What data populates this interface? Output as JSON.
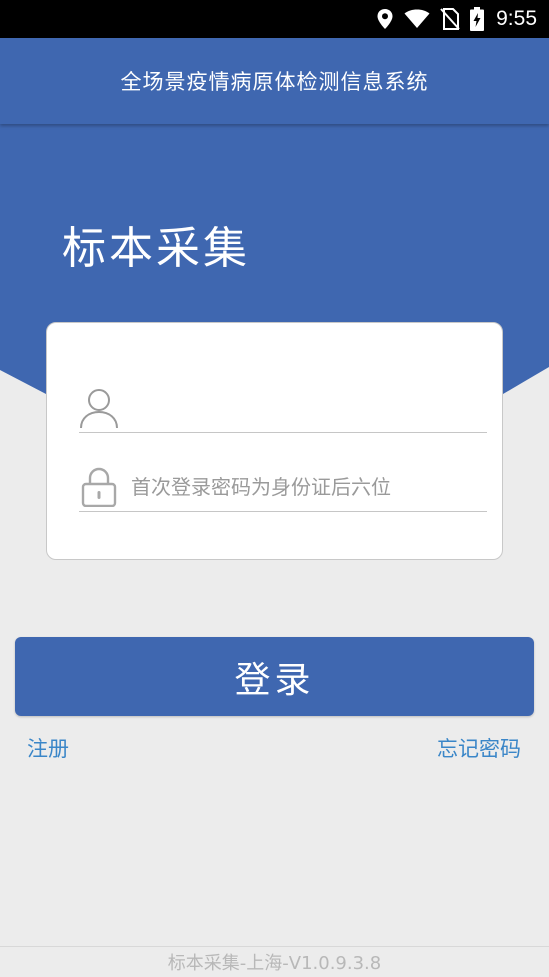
{
  "status_bar": {
    "time": "9:55",
    "icons": [
      "location-icon",
      "wifi-icon",
      "no-sim-icon",
      "battery-charging-icon"
    ]
  },
  "header": {
    "title": "全场景疫情病原体检测信息系统"
  },
  "hero": {
    "title": "标本采集"
  },
  "login": {
    "username_value": "",
    "password_placeholder": "首次登录密码为身份证后六位",
    "submit_label": "登录"
  },
  "links": {
    "register": "注册",
    "forgot_password": "忘记密码"
  },
  "footer": {
    "version": "标本采集-上海-V1.0.9.3.8"
  },
  "colors": {
    "primary": "#3f67b0",
    "link": "#3a86c8",
    "background": "#ececec"
  }
}
